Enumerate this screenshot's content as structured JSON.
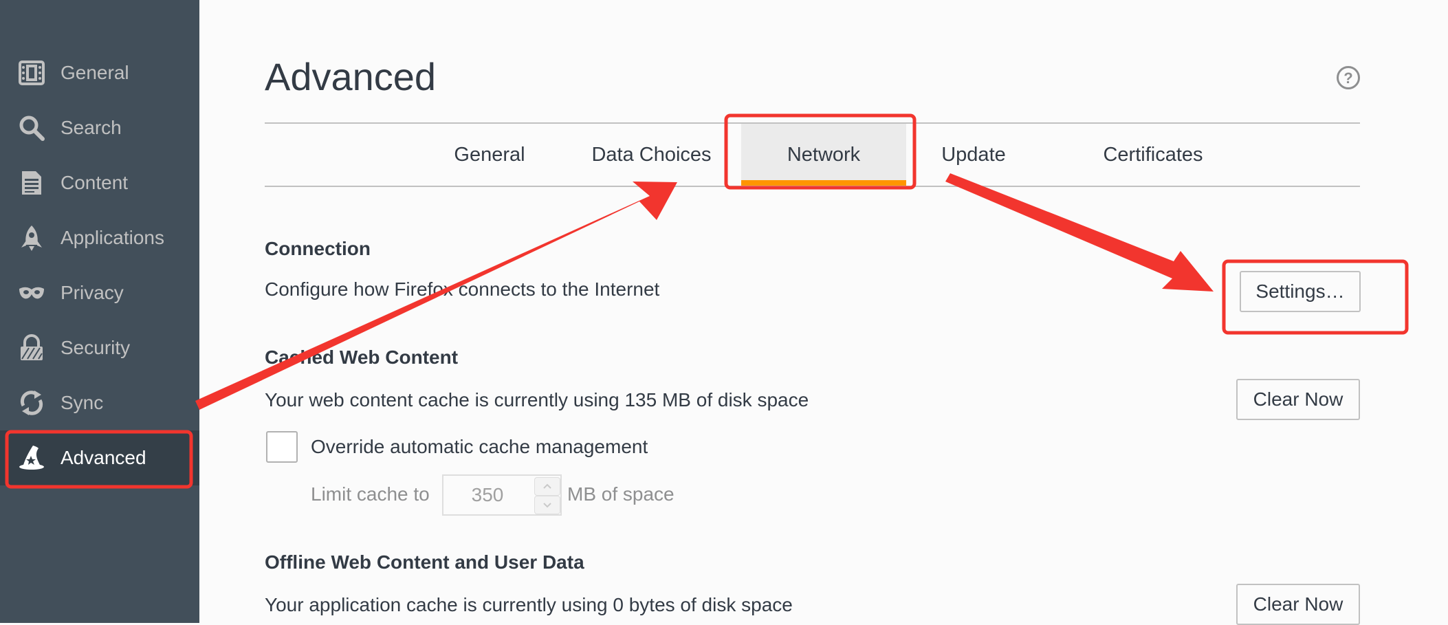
{
  "sidebar": {
    "items": [
      {
        "label": "General",
        "icon": "general-icon"
      },
      {
        "label": "Search",
        "icon": "search-icon"
      },
      {
        "label": "Content",
        "icon": "content-icon"
      },
      {
        "label": "Applications",
        "icon": "applications-icon"
      },
      {
        "label": "Privacy",
        "icon": "privacy-icon"
      },
      {
        "label": "Security",
        "icon": "security-icon"
      },
      {
        "label": "Sync",
        "icon": "sync-icon"
      },
      {
        "label": "Advanced",
        "icon": "advanced-icon",
        "selected": true
      }
    ]
  },
  "page": {
    "title": "Advanced",
    "help_icon": "question-mark-icon"
  },
  "tabs": [
    {
      "label": "General"
    },
    {
      "label": "Data Choices"
    },
    {
      "label": "Network",
      "selected": true
    },
    {
      "label": "Update"
    },
    {
      "label": "Certificates"
    }
  ],
  "connection": {
    "title": "Connection",
    "description": "Configure how Firefox connects to the Internet",
    "settings_button": "Settings…"
  },
  "cache": {
    "title": "Cached Web Content",
    "description": "Your web content cache is currently using 135 MB of disk space",
    "clear_button": "Clear Now",
    "override_label": "Override automatic cache management",
    "override_checked": false,
    "limit_prefix": "Limit cache to",
    "limit_value": "350",
    "limit_suffix": "MB of space"
  },
  "offline": {
    "title": "Offline Web Content and User Data",
    "description": "Your application cache is currently using 0 bytes of disk space",
    "clear_button": "Clear Now"
  },
  "colors": {
    "sidebar_bg": "#424f5a",
    "sidebar_selected_bg": "#343f48",
    "tab_accent": "#ff9500",
    "annotation_red": "#f2352e"
  }
}
